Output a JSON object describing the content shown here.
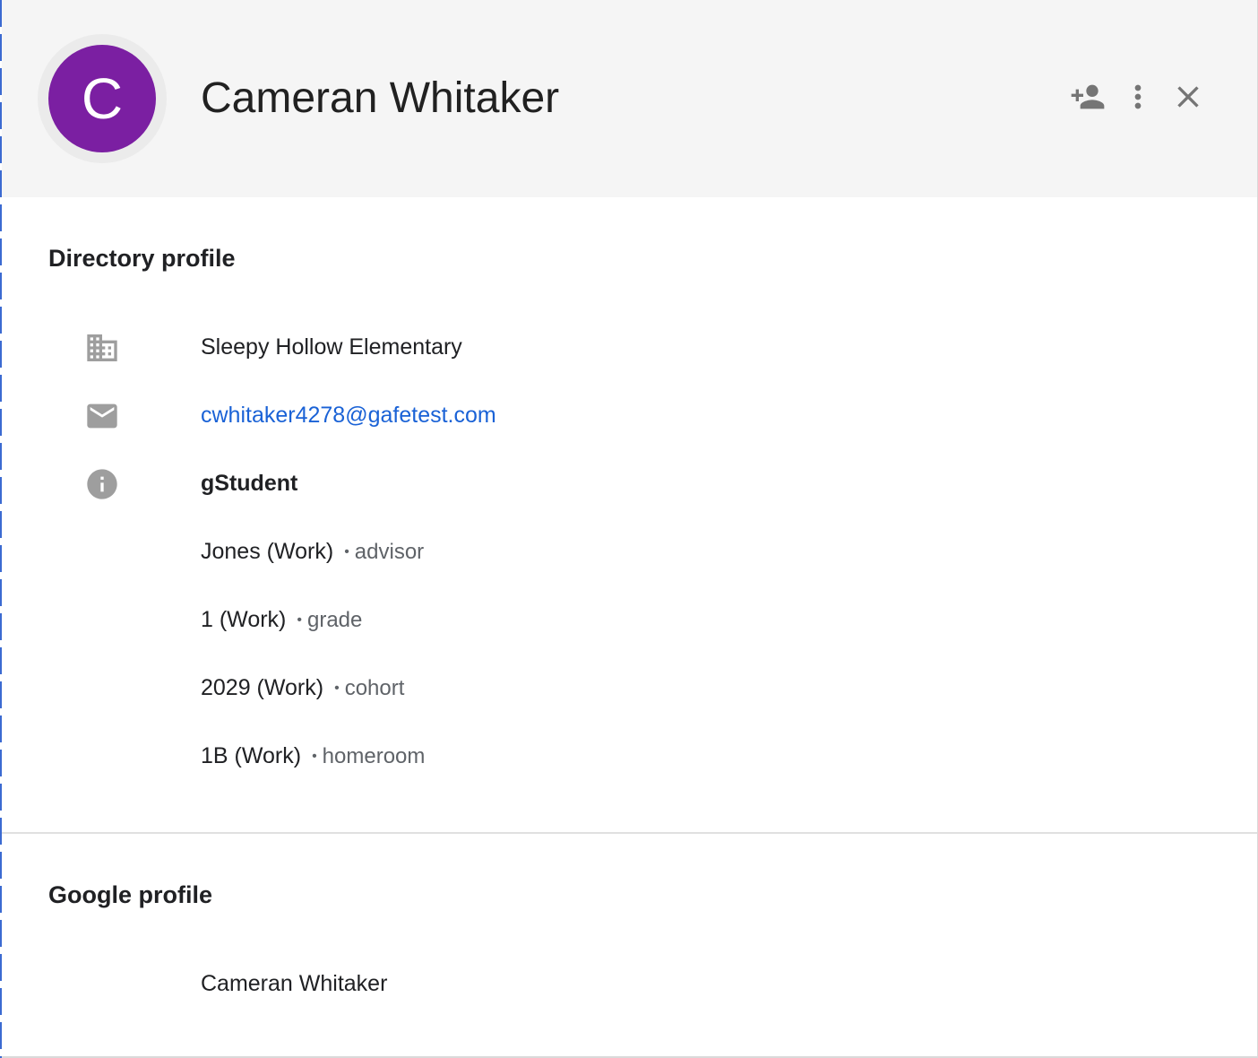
{
  "header": {
    "avatar_initial": "C",
    "name": "Cameran Whitaker",
    "avatar_color": "#7b1fa2",
    "actions": [
      {
        "icon": "person-add-icon"
      },
      {
        "icon": "more-vert-icon"
      },
      {
        "icon": "close-icon"
      }
    ]
  },
  "directory": {
    "title": "Directory profile",
    "organization": "Sleepy Hollow Elementary",
    "email": "cwhitaker4278@gafetest.com",
    "role": "gStudent",
    "fields": [
      {
        "value": "Jones (Work)",
        "type": "advisor"
      },
      {
        "value": "1 (Work)",
        "type": "grade"
      },
      {
        "value": "2029 (Work)",
        "type": "cohort"
      },
      {
        "value": "1B (Work)",
        "type": "homeroom"
      }
    ],
    "separator": "•"
  },
  "google": {
    "title": "Google profile",
    "name": "Cameran Whitaker"
  },
  "colors": {
    "link": "#1a62d6",
    "header_bg": "#f5f5f5",
    "icon_gray": "#757575"
  }
}
